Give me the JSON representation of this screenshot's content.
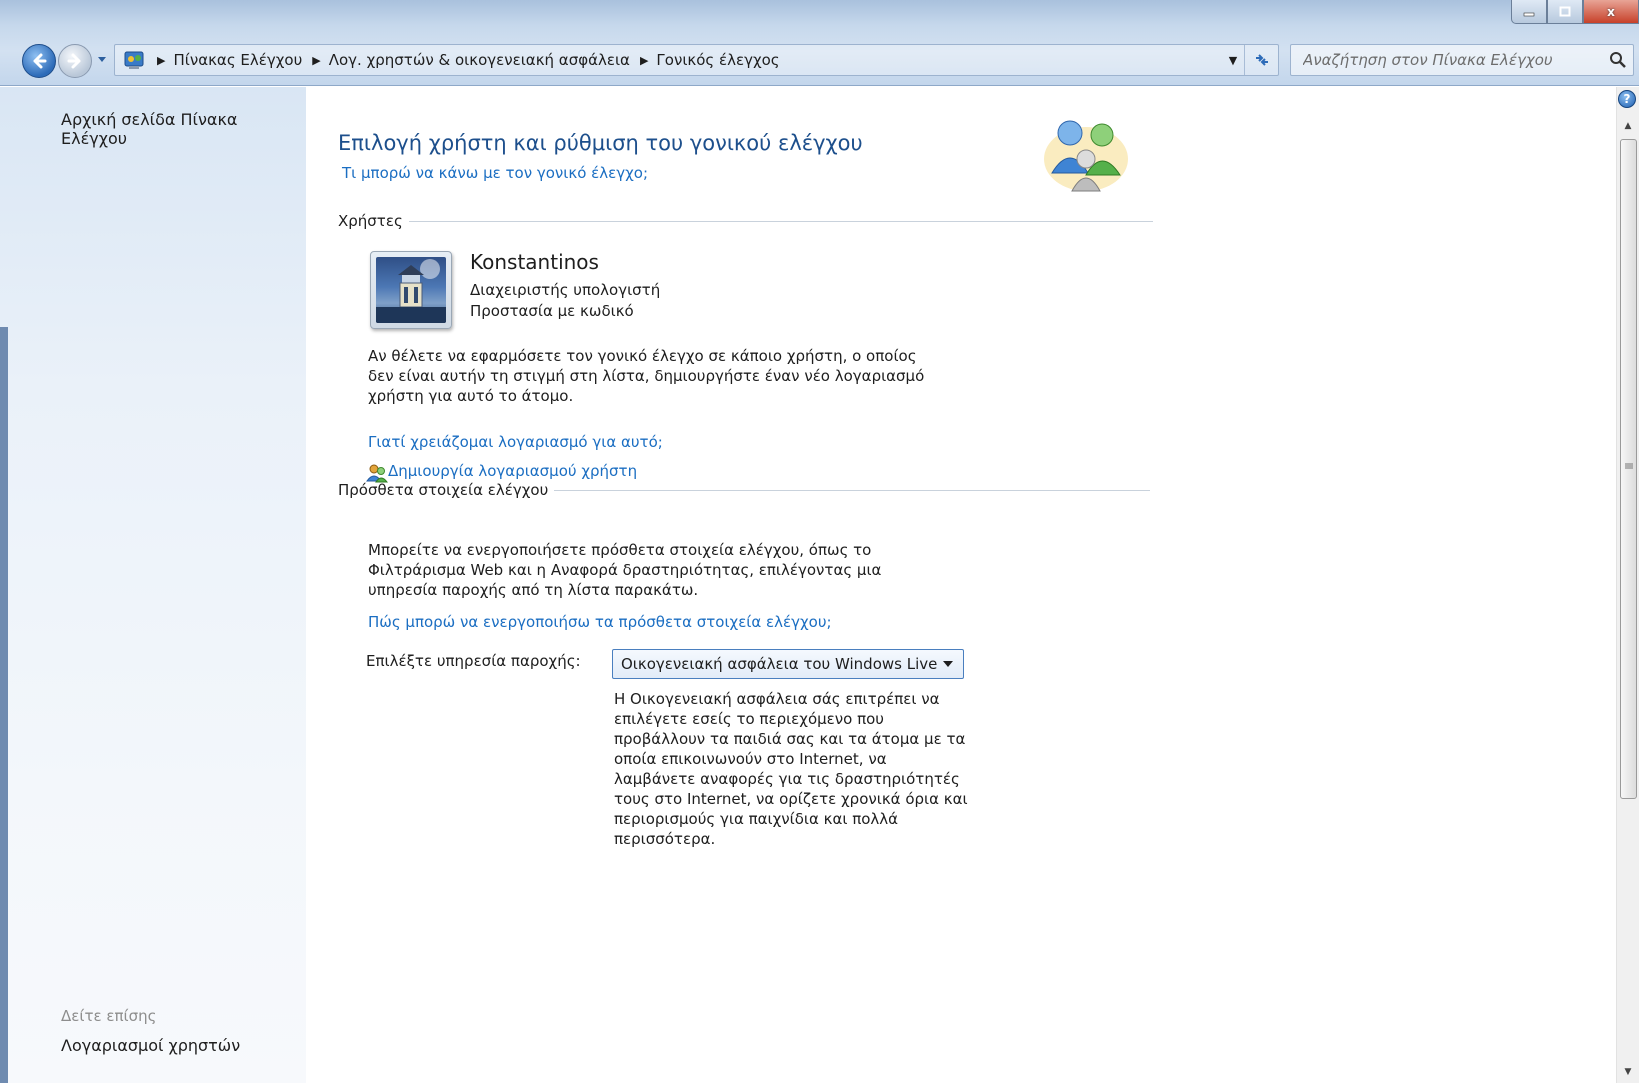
{
  "window": {
    "minimize_icon": "minimize-icon",
    "maximize_icon": "maximize-icon",
    "close_icon": "close-icon",
    "close_label": "x"
  },
  "addressbar": {
    "breadcrumbs": [
      "Πίνακας Ελέγχου",
      "Λογ. χρηστών & οικογενειακή ασφάλεια",
      "Γονικός έλεγχος"
    ],
    "search_placeholder": "Αναζήτηση στον Πίνακα Ελέγχου"
  },
  "sidebar": {
    "home": "Αρχική σελίδα Πίνακα Ελέγχου",
    "see_also": "Δείτε επίσης",
    "accounts": "Λογαριασμοί χρηστών"
  },
  "main": {
    "title": "Επιλογή χρήστη και ρύθμιση του γονικού ελέγχου",
    "help_link": "Τι μπορώ να κάνω με τον γονικό έλεγχο;",
    "users_section": "Χρήστες",
    "user": {
      "name": "Konstantinos",
      "role": "Διαχειριστής υπολογιστή",
      "password": "Προστασία με κωδικό"
    },
    "new_user_text": [
      "Αν θέλετε να εφαρμόσετε τον γονικό έλεγχο σε κάποιο χρήστη, ο οποίος",
      "δεν είναι αυτήν τη στιγμή στη λίστα, δημιουργήστε έναν νέο λογαριασμό",
      "χρήστη για αυτό το άτομο."
    ],
    "why_link": "Γιατί χρειάζομαι λογαριασμό για αυτό;",
    "create_link": "Δημιουργία λογαριασμού χρήστη",
    "extra_section": "Πρόσθετα στοιχεία ελέγχου",
    "extra_text": [
      "Μπορείτε να ενεργοποιήσετε πρόσθετα στοιχεία ελέγχου, όπως το",
      "Φιλτράρισμα Web και η Αναφορά δραστηριότητας, επιλέγοντας μια",
      "υπηρεσία παροχής από τη λίστα παρακάτω."
    ],
    "extra_link": "Πώς μπορώ να ενεργοποιήσω τα πρόσθετα στοιχεία ελέγχου;",
    "provider_label": "Επιλέξτε υπηρεσία παροχής:",
    "provider_value": "Οικογενειακή ασφάλεια του Windows Live",
    "provider_desc": [
      "Η Οικογενειακή ασφάλεια σάς επιτρέπει να",
      "επιλέγετε εσείς το περιεχόμενο που",
      "προβάλλουν τα παιδιά σας και τα άτομα με τα",
      "οποία επικοινωνούν στο Internet, να",
      "λαμβάνετε αναφορές για τις δραστηριότητές",
      "τους στο Internet, να ορίζετε χρονικά όρια και",
      "περιορισμούς για παιχνίδια και πολλά",
      "περισσότερα."
    ]
  },
  "colors": {
    "title_blue": "#1d4f8c",
    "link_blue": "#1b6ec2"
  }
}
